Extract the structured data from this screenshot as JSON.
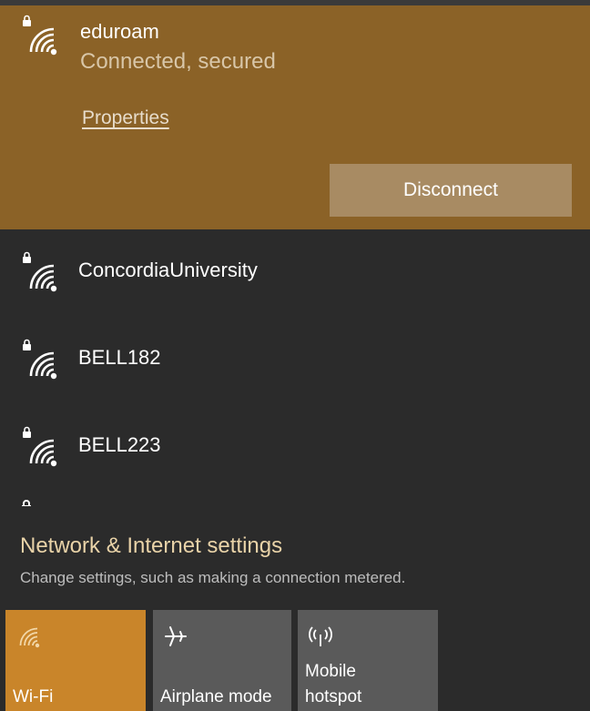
{
  "connected_network": {
    "name": "eduroam",
    "status": "Connected, secured",
    "properties_label": "Properties",
    "disconnect_label": "Disconnect"
  },
  "networks": [
    {
      "name": "ConcordiaUniversity",
      "icon": "secured-wifi-icon"
    },
    {
      "name": "BELL182",
      "icon": "secured-wifi-icon"
    },
    {
      "name": "BELL223",
      "icon": "secured-wifi-icon"
    }
  ],
  "settings": {
    "title": "Network & Internet settings",
    "description": "Change settings, such as making a connection metered."
  },
  "quick_actions": [
    {
      "label": "Wi-Fi",
      "icon": "wifi-icon",
      "active": true
    },
    {
      "label": "Airplane mode",
      "icon": "airplane-icon",
      "active": false
    },
    {
      "label_line1": "Mobile",
      "label_line2": "hotspot",
      "icon": "hotspot-icon",
      "active": false
    }
  ],
  "colors": {
    "accent": "#c9852a",
    "connected_bg": "#8b6227",
    "flyout_bg": "#2b2b2b",
    "tile_inactive": "#5a5a5a"
  }
}
